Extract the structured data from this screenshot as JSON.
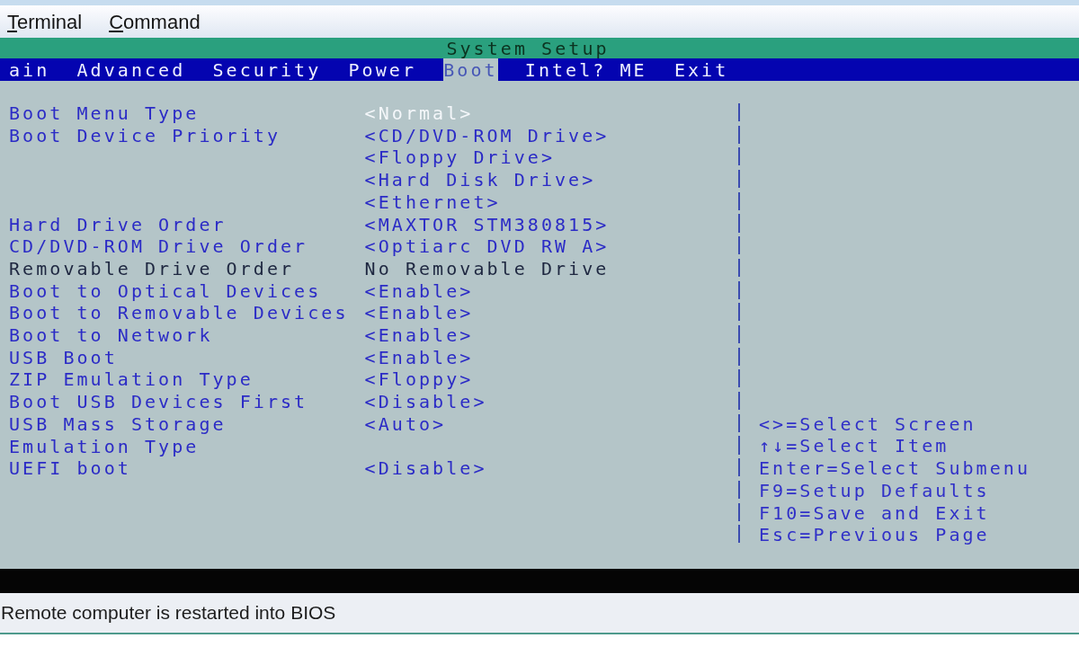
{
  "menu_bar": {
    "items": [
      "Terminal",
      "Command"
    ]
  },
  "title_bar": {
    "title": "System Setup"
  },
  "tabs": [
    {
      "label": "ain",
      "selected": false
    },
    {
      "label": "Advanced",
      "selected": false
    },
    {
      "label": "Security",
      "selected": false
    },
    {
      "label": "Power",
      "selected": false
    },
    {
      "label": "Boot",
      "selected": true
    },
    {
      "label": "Intel? ME",
      "selected": false
    },
    {
      "label": "Exit",
      "selected": false
    }
  ],
  "settings": [
    {
      "label": "Boot Menu Type",
      "values": [
        "<Normal>"
      ],
      "selected": true,
      "disabled": false
    },
    {
      "label": "Boot Device Priority",
      "values": [
        "<CD/DVD-ROM Drive>",
        "<Floppy Drive>",
        "<Hard Disk Drive>",
        "<Ethernet>"
      ],
      "selected": false,
      "disabled": false
    },
    {
      "label": "Hard Drive Order",
      "values": [
        "<MAXTOR STM380815>"
      ],
      "selected": false,
      "disabled": false
    },
    {
      "label": "CD/DVD-ROM Drive Order",
      "values": [
        "<Optiarc DVD RW A>"
      ],
      "selected": false,
      "disabled": false
    },
    {
      "label": "Removable Drive Order",
      "values": [
        "No Removable Drive"
      ],
      "selected": false,
      "disabled": true
    },
    {
      "label": "Boot to Optical Devices",
      "values": [
        "<Enable>"
      ],
      "selected": false,
      "disabled": false
    },
    {
      "label": "Boot to Removable Devices",
      "values": [
        "<Enable>"
      ],
      "selected": false,
      "disabled": false
    },
    {
      "label": "Boot to Network",
      "values": [
        "<Enable>"
      ],
      "selected": false,
      "disabled": false
    },
    {
      "label": "USB Boot",
      "values": [
        "<Enable>"
      ],
      "selected": false,
      "disabled": false
    },
    {
      "label": "ZIP Emulation Type",
      "values": [
        "<Floppy>"
      ],
      "selected": false,
      "disabled": false
    },
    {
      "label": "Boot USB Devices First",
      "values": [
        "<Disable>"
      ],
      "selected": false,
      "disabled": false
    },
    {
      "label": "USB Mass Storage Emulation Type",
      "values": [
        "<Auto>"
      ],
      "selected": false,
      "disabled": false
    },
    {
      "label": "UEFI boot",
      "values": [
        "<Disable>"
      ],
      "selected": false,
      "disabled": false
    }
  ],
  "help": [
    "<>=Select Screen",
    "↑↓=Select Item",
    "Enter=Select Submenu",
    "F9=Setup Defaults",
    "F10=Save and Exit",
    "Esc=Previous Page"
  ],
  "status_bar": {
    "text": "Remote computer is restarted into BIOS"
  }
}
